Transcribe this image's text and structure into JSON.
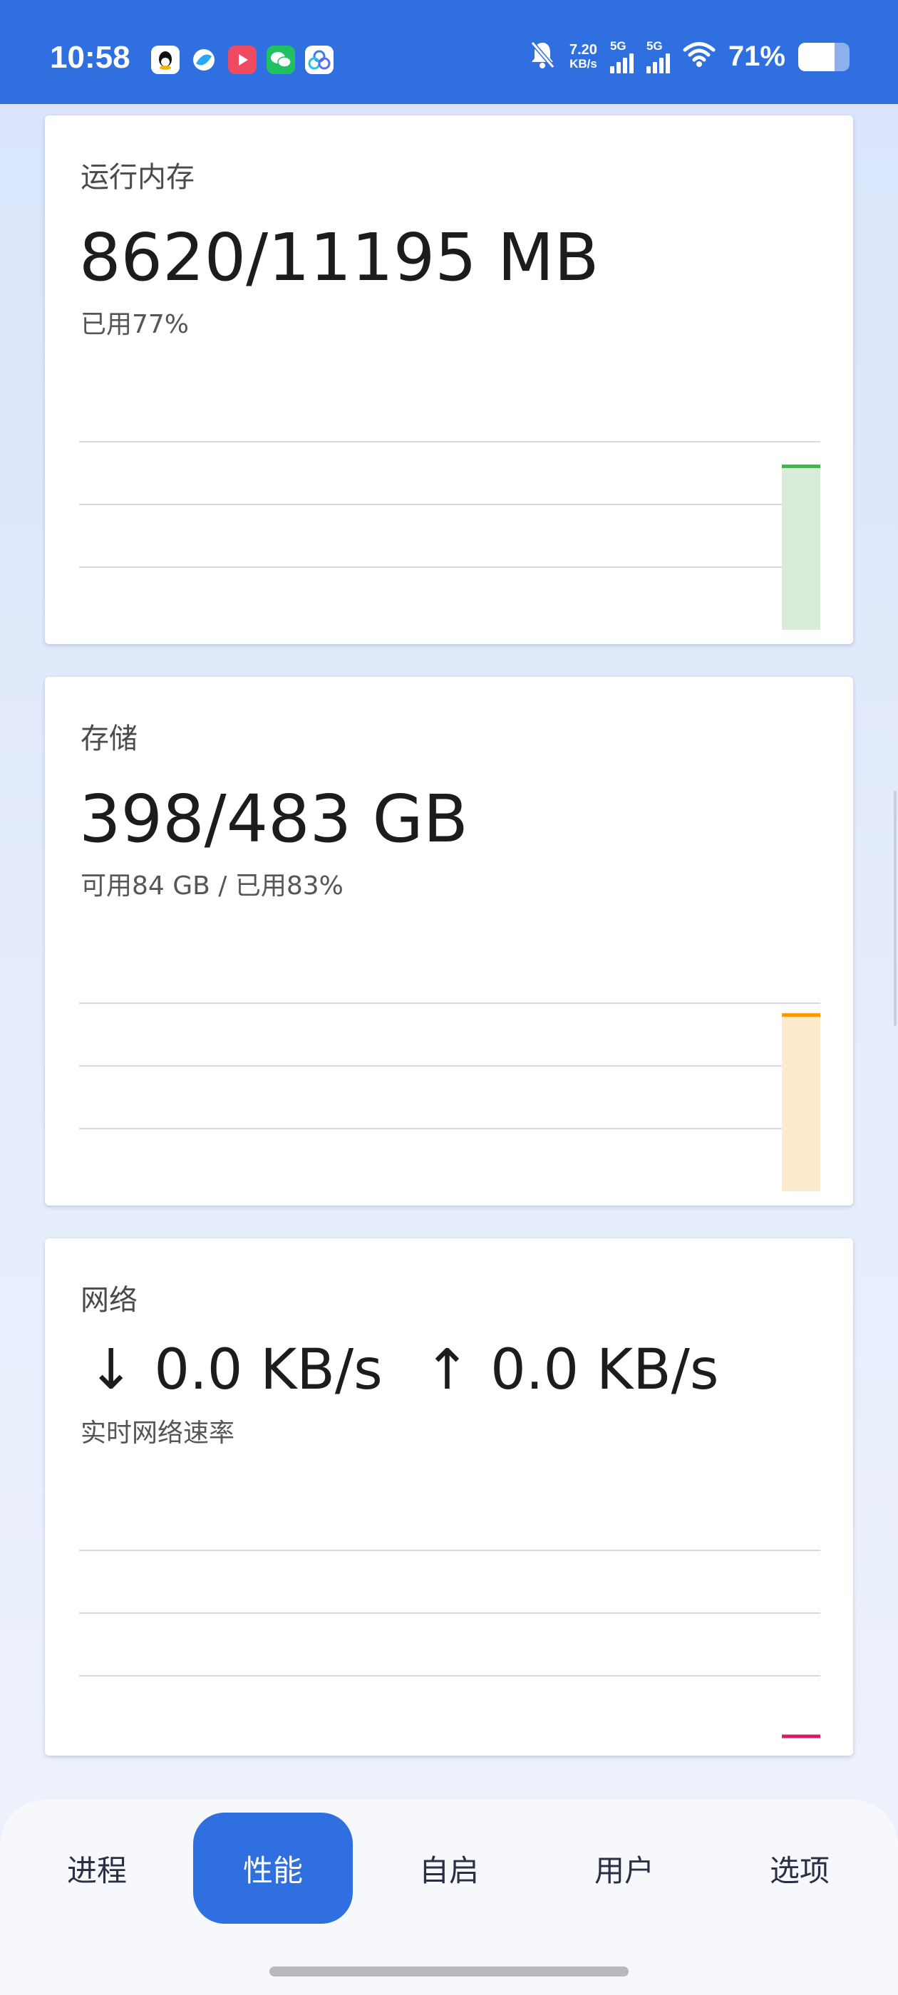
{
  "status_bar": {
    "time": "10:58",
    "net_speed_value": "7.20",
    "net_speed_unit": "KB/s",
    "sim1_label": "5G",
    "sim2_label": "5G",
    "battery_pct": "71%",
    "battery_level": 0.71,
    "apps": [
      "qq-icon",
      "browser-icon",
      "video-icon",
      "wechat-icon",
      "cloud-icon"
    ]
  },
  "memory": {
    "title": "运行内存",
    "value": "8620/11195 MB",
    "sub": "已用77%",
    "used_ratio": 0.77,
    "color": "#4caf50",
    "fill_color": "#d8ecd8"
  },
  "storage": {
    "title": "存储",
    "value": "398/483 GB",
    "sub": "可用84 GB / 已用83%",
    "used_ratio": 0.83,
    "color": "#ff9800",
    "fill_color": "#fdebcf"
  },
  "network": {
    "title": "网络",
    "down_arrow": "↓",
    "down_value": "0.0 KB/s",
    "up_arrow": "↑",
    "up_value": "0.0 KB/s",
    "sub": "实时网络速率",
    "color": "#d81b60",
    "current_ratio": 0.0
  },
  "nav": {
    "items": [
      "进程",
      "性能",
      "自启",
      "用户",
      "选项"
    ],
    "active_index": 1,
    "accent": "#2f6fe0"
  }
}
